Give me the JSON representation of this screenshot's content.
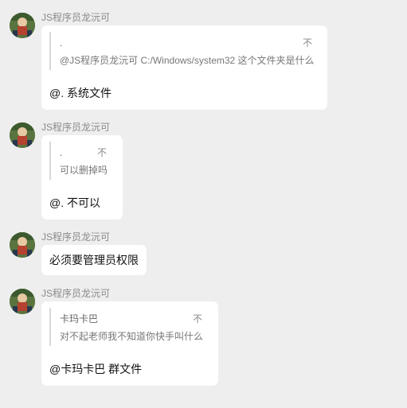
{
  "messages": [
    {
      "sender": "JS程序员龙沅可",
      "quote": {
        "title": ".",
        "tag": "不",
        "text": "@JS程序员龙沅可 C:/Windows/system32 这个文件夹是什么"
      },
      "reply": "@. 系统文件"
    },
    {
      "sender": "JS程序员龙沅可",
      "quote": {
        "title": ".",
        "tag": "不",
        "text": "可以删掉吗"
      },
      "reply": "@. 不可以"
    },
    {
      "sender": "JS程序员龙沅可",
      "text": "必须要管理员权限"
    },
    {
      "sender": "JS程序员龙沅可",
      "quote": {
        "title": "卡玛卡巴",
        "tag": "不",
        "text": "对不起老师我不知道你快手叫什么"
      },
      "reply": "@卡玛卡巴 群文件"
    }
  ],
  "colors": {
    "background": "#eeeeee",
    "bubble": "#ffffff",
    "sender": "#8a8a8a"
  },
  "icons": {
    "avatar": "user-avatar-icon"
  }
}
